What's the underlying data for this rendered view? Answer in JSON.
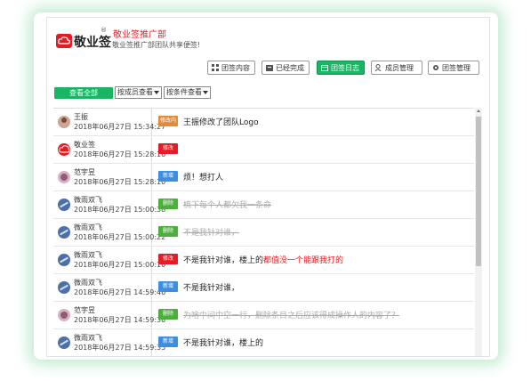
{
  "header": {
    "brand": "敬业签",
    "reg": "®",
    "team_name": "敬业签推广部",
    "team_desc": "敬业签推广部团队共享便签!"
  },
  "tabs": [
    {
      "label": "团签内容",
      "icon": "grid-icon"
    },
    {
      "label": "已经完成",
      "icon": "archive-icon"
    },
    {
      "label": "团签日志",
      "icon": "calendar-icon",
      "active": true
    },
    {
      "label": "成员管理",
      "icon": "users-icon"
    },
    {
      "label": "团签管理",
      "icon": "gear-icon"
    }
  ],
  "filters": {
    "view_all": "查看全部",
    "by_member": "按成员查看",
    "by_condition": "按条件查看"
  },
  "log": [
    {
      "user": "王振",
      "time": "2018年06月27日 15:34:27",
      "badge": "修改内容",
      "badge_color": "#e08a3c",
      "content": "王振修改了团队Logo",
      "avatar": "person"
    },
    {
      "user": "敬业签",
      "time": "2018年06月27日 15:28:16",
      "badge": "修改",
      "badge_color": "#e51c23",
      "content": "",
      "avatar": "brand"
    },
    {
      "user": "范宇昱",
      "time": "2018年06月27日 15:28:10",
      "badge": "新增",
      "badge_color": "#3c8ee0",
      "content": "烦！想打人",
      "avatar": "girl"
    },
    {
      "user": "微雨双飞",
      "time": "2018年06月27日 15:00:38",
      "badge": "删除",
      "badge_color": "#4cae3d",
      "content": "梳下每个人都欠我一条命",
      "avatar": "planet",
      "strike": true
    },
    {
      "user": "微雨双飞",
      "time": "2018年06月27日 15:00:22",
      "badge": "删除",
      "badge_color": "#4cae3d",
      "content": "不是我针对谁，",
      "avatar": "planet",
      "strike": true
    },
    {
      "user": "微雨双飞",
      "time": "2018年06月27日 15:00:10",
      "badge": "修改",
      "badge_color": "#e51c23",
      "content": "不是我针对谁，楼上的",
      "content_red": "都值没一个能跟我打的",
      "avatar": "planet"
    },
    {
      "user": "微雨双飞",
      "time": "2018年06月27日 14:59:46",
      "badge": "新增",
      "badge_color": "#3c8ee0",
      "content": "不是我针对谁，",
      "avatar": "planet"
    },
    {
      "user": "范宇昱",
      "time": "2018年06月27日 14:59:38",
      "badge": "删除",
      "badge_color": "#4cae3d",
      "content": "为啥中间中空一行，删除条目之后应该得成操作人的内容了？",
      "avatar": "girl",
      "strike": true
    },
    {
      "user": "微雨双飞",
      "time": "2018年06月27日 14:59:35",
      "badge": "新增",
      "badge_color": "#3c8ee0",
      "content": "不是我针对谁，楼上的",
      "avatar": "planet"
    }
  ]
}
